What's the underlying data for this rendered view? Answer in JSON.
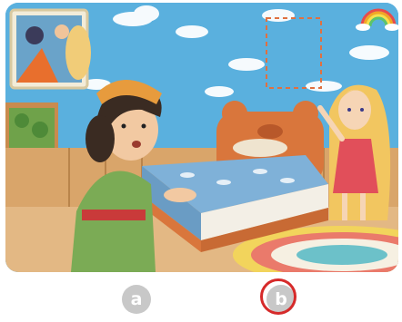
{
  "scene": {
    "description_shown": "",
    "colors": {
      "sky_wall": "#5ab0de",
      "floor": "#e3b884",
      "bed_frame": "#d9763c",
      "blanket": "#7fb1d8",
      "selection_ring": "#d62a2a",
      "option_circle": "#c8c8c8"
    },
    "icons": [
      "rainbow-icon",
      "dashed-frame-outline",
      "framed-picture",
      "window-plants",
      "round-rug"
    ]
  },
  "options": {
    "a": {
      "label": "a",
      "selected": false
    },
    "b": {
      "label": "b",
      "selected": true
    }
  }
}
